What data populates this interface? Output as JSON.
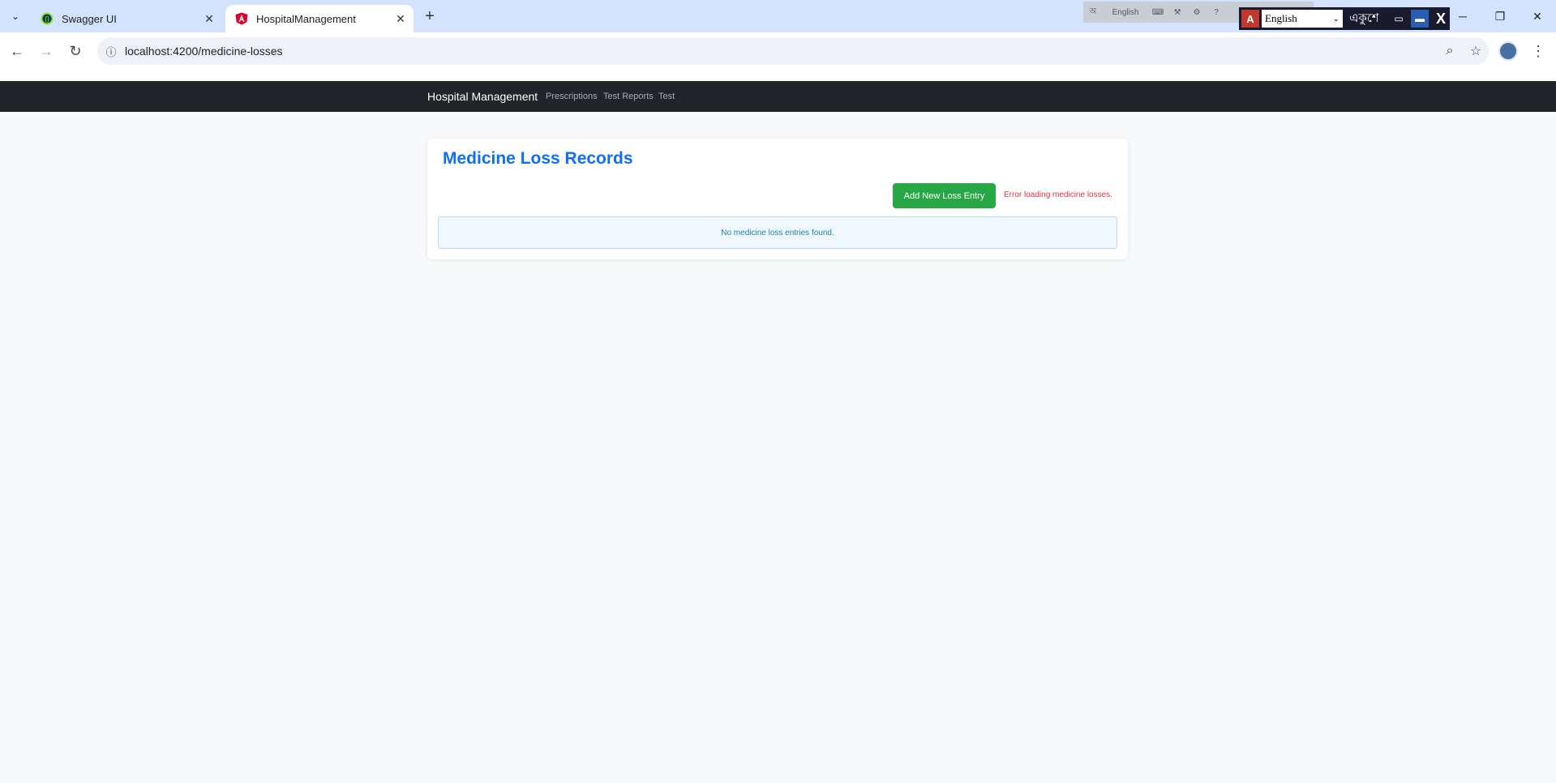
{
  "browser": {
    "tabs": [
      {
        "title": "Swagger UI",
        "icon": "swagger-icon",
        "active": false
      },
      {
        "title": "HospitalManagement",
        "icon": "angular-icon",
        "active": true
      }
    ],
    "url": "localhost:4200/medicine-losses"
  },
  "ime": {
    "mini_language": "English",
    "language": "English",
    "font_label": "একুশে"
  },
  "app": {
    "brand": "Hospital Management",
    "nav": [
      {
        "label": "Prescriptions"
      },
      {
        "label": "Test Reports"
      },
      {
        "label": "Test"
      }
    ]
  },
  "page": {
    "title": "Medicine Loss Records",
    "add_button_label": "Add New Loss Entry",
    "error_message": "Error loading medicine losses.",
    "empty_message": "No medicine loss entries found."
  },
  "colors": {
    "navbar": "#212529",
    "title": "#0d6efd",
    "add_button": "#28a745",
    "error": "#dc3545",
    "info_text": "#1b7fa8"
  }
}
